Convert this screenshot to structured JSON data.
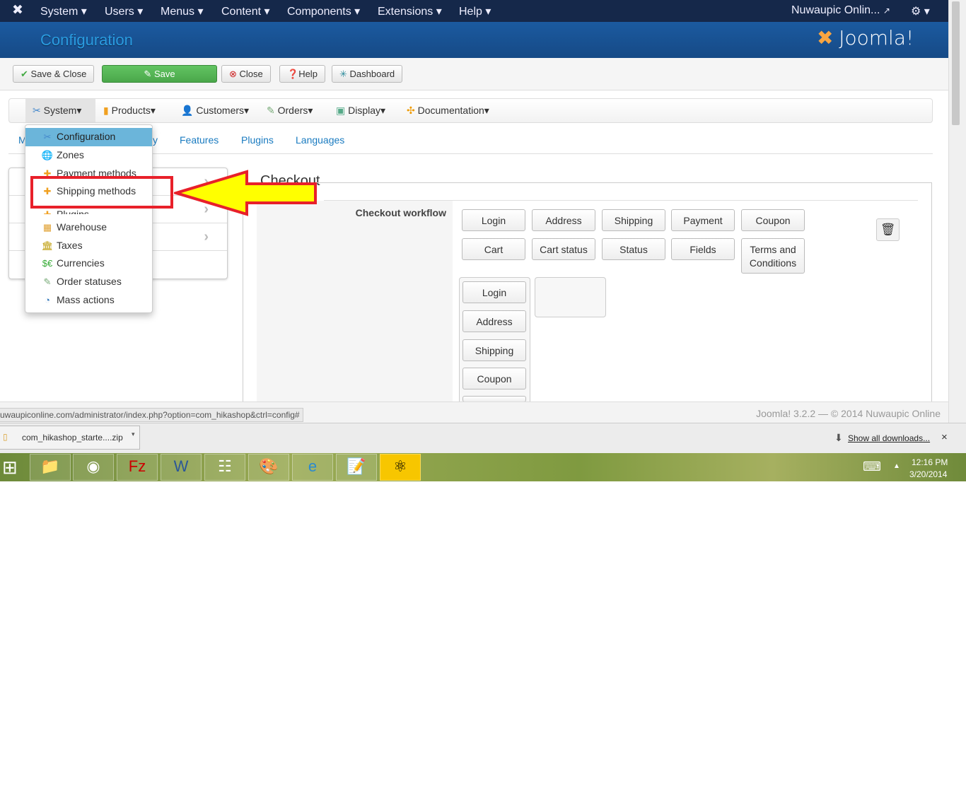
{
  "topmenu": {
    "items": [
      "System",
      "Users",
      "Menus",
      "Content",
      "Components",
      "Extensions",
      "Help"
    ],
    "site": "Nuwaupic Onlin...",
    "icons": [
      "joomla-icon",
      "gear-icon"
    ]
  },
  "header": {
    "title": "Configuration",
    "logo": "Joomla!"
  },
  "toolbar": {
    "save_close": "Save & Close",
    "save": "Save",
    "close": "Close",
    "help": "Help",
    "dashboard": "Dashboard"
  },
  "hnav": {
    "items": [
      "System",
      "Products",
      "Customers",
      "Orders",
      "Display",
      "Documentation"
    ]
  },
  "tabs": {
    "first": "M",
    "partial": "y",
    "features": "Features",
    "plugins": "Plugins",
    "languages": "Languages"
  },
  "dropdown": {
    "items": [
      "Configuration",
      "Zones",
      "Payment methods",
      "Shipping methods",
      "Plugins",
      "Warehouse",
      "Taxes",
      "Currencies",
      "Order statuses",
      "Mass actions"
    ],
    "active": "Configuration",
    "highlighted": "Shipping methods"
  },
  "checkout": {
    "legend": "Checkout",
    "workflow_label": "Checkout workflow",
    "grid": [
      "Login",
      "Address",
      "Shipping",
      "Payment",
      "Coupon",
      "Cart",
      "Cart status",
      "Status",
      "Fields",
      "Terms and Conditions"
    ],
    "column": [
      "Login",
      "Address",
      "Shipping",
      "Coupon"
    ]
  },
  "footer": {
    "text": "Joomla! 3.2.2  —  © 2014 Nuwaupic Online"
  },
  "status_url": "uwaupiconline.com/administrator/index.php?option=com_hikashop&ctrl=config#",
  "downloads": {
    "file": "com_hikashop_starte....zip",
    "show_all": "Show all downloads...",
    "close": "×"
  },
  "taskbar": {
    "time": "12:16 PM",
    "date": "3/20/2014"
  },
  "colors": {
    "topbar": "#15284a",
    "header": "#1b5aa0",
    "save": "#5cb85c",
    "highlight_box": "#e8202a",
    "arrow": "#ffff00"
  }
}
